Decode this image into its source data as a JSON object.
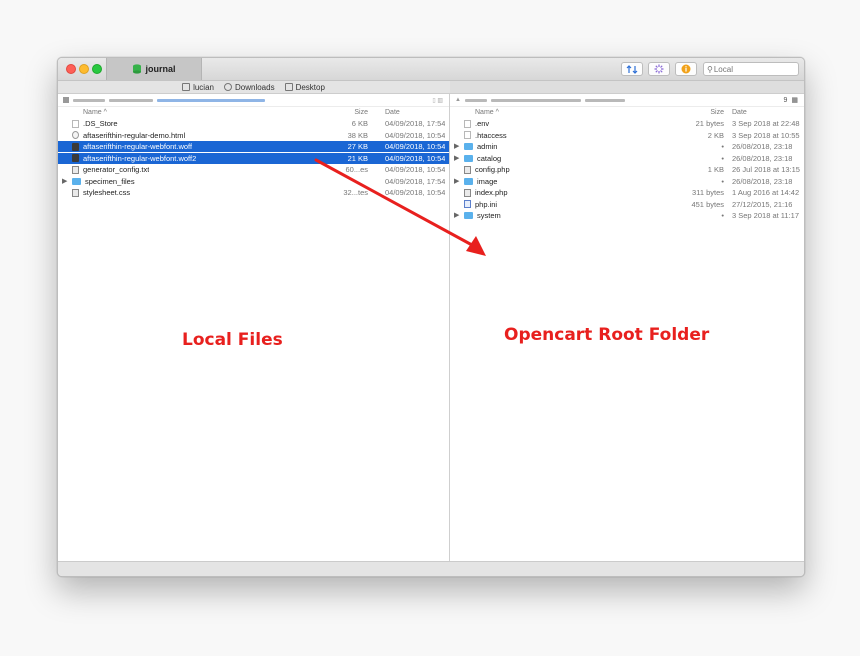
{
  "window": {
    "tab_title": "journal",
    "toolbar": {
      "search_placeholder": "Local"
    }
  },
  "location_bar": {
    "items": [
      {
        "label": "lucian",
        "icon": "home-icon"
      },
      {
        "label": "Downloads",
        "icon": "download-icon"
      },
      {
        "label": "Desktop",
        "icon": "desktop-icon"
      }
    ]
  },
  "left_pane": {
    "columns": {
      "name": "Name ^",
      "size": "Size",
      "date": "Date"
    },
    "files": [
      {
        "name": ".DS_Store",
        "size": "6 KB",
        "date": "04/09/2018, 17:54",
        "icon": "document-icon",
        "selected": false,
        "folder": false
      },
      {
        "name": "aftaserifthin-regular-demo.html",
        "size": "38 KB",
        "date": "04/09/2018, 10:54",
        "icon": "html-file-icon",
        "selected": false,
        "folder": false
      },
      {
        "name": "aftaserifthin-regular-webfont.woff",
        "size": "27 KB",
        "date": "04/09/2018, 10:54",
        "icon": "font-file-icon",
        "selected": true,
        "folder": false
      },
      {
        "name": "aftaserifthin-regular-webfont.woff2",
        "size": "21 KB",
        "date": "04/09/2018, 10:54",
        "icon": "font-file-icon",
        "selected": true,
        "folder": false
      },
      {
        "name": "generator_config.txt",
        "size": "60...es",
        "date": "04/09/2018, 10:54",
        "icon": "text-file-icon",
        "selected": false,
        "folder": false
      },
      {
        "name": "specimen_files",
        "size": "",
        "date": "04/09/2018, 17:54",
        "icon": "folder-icon",
        "selected": false,
        "folder": true
      },
      {
        "name": "stylesheet.css",
        "size": "32...tes",
        "date": "04/09/2018, 10:54",
        "icon": "css-file-icon",
        "selected": false,
        "folder": false
      }
    ]
  },
  "right_pane": {
    "item_count": "9",
    "columns": {
      "name": "Name ^",
      "size": "Size",
      "date": "Date"
    },
    "files": [
      {
        "name": ".env",
        "size": "21 bytes",
        "date": "3 Sep 2018 at 22:48",
        "icon": "document-icon",
        "folder": false
      },
      {
        "name": ".htaccess",
        "size": "2 KB",
        "date": "3 Sep 2018 at 10:55",
        "icon": "document-icon",
        "folder": false
      },
      {
        "name": "admin",
        "size": "•",
        "date": "26/08/2018, 23:18",
        "icon": "folder-icon",
        "folder": true
      },
      {
        "name": "catalog",
        "size": "•",
        "date": "26/08/2018, 23:18",
        "icon": "folder-icon",
        "folder": true
      },
      {
        "name": "config.php",
        "size": "1 KB",
        "date": "26 Jul 2018 at 13:15",
        "icon": "php-file-icon",
        "folder": false
      },
      {
        "name": "image",
        "size": "•",
        "date": "26/08/2018, 23:18",
        "icon": "folder-icon",
        "folder": true
      },
      {
        "name": "index.php",
        "size": "311 bytes",
        "date": "1 Aug 2016 at 14:42",
        "icon": "php-file-icon",
        "folder": false
      },
      {
        "name": "php.ini",
        "size": "451 bytes",
        "date": "27/12/2015, 21:16",
        "icon": "ini-file-icon",
        "folder": false
      },
      {
        "name": "system",
        "size": "•",
        "date": "3 Sep 2018 at 11:17",
        "icon": "folder-icon",
        "folder": true
      }
    ]
  },
  "annotations": {
    "left_label": "Local Files",
    "right_label": "Opencart Root Folder",
    "arrow_color": "#e8201e"
  },
  "colors": {
    "selection": "#1a66d4",
    "folder": "#5ab1ec",
    "annotation_red": "#e8201e"
  }
}
